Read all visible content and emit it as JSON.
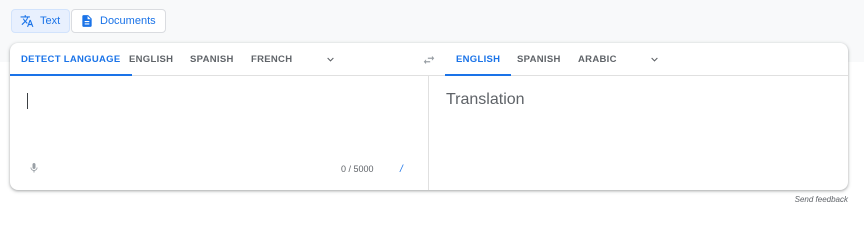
{
  "modes": {
    "text_label": "Text",
    "documents_label": "Documents"
  },
  "source": {
    "tabs": [
      "DETECT LANGUAGE",
      "ENGLISH",
      "SPANISH",
      "FRENCH"
    ],
    "active_tab": "DETECT LANGUAGE",
    "input_value": "",
    "char_counter": "0 / 5000",
    "edit_glyph": "/"
  },
  "target": {
    "tabs": [
      "ENGLISH",
      "SPANISH",
      "ARABIC"
    ],
    "active_tab": "ENGLISH",
    "placeholder": "Translation"
  },
  "footer": {
    "send_feedback": "Send feedback"
  },
  "icons": [
    "translate-icon",
    "document-icon",
    "chevron-down-icon",
    "swap-languages-icon",
    "microphone-icon"
  ],
  "colors": {
    "accent": "#1a73e8",
    "text": "#5f6368"
  }
}
